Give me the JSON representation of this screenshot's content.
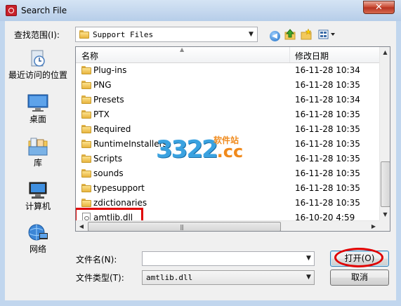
{
  "window": {
    "title": "Search File",
    "close_label": "✕"
  },
  "toolbar": {
    "look_in_label": "查找范围(I):",
    "look_in_value": "Support Files",
    "icons": [
      "back-icon",
      "up-folder-icon",
      "new-folder-icon",
      "views-menu-icon"
    ]
  },
  "places": [
    {
      "label": "最近访问的位置",
      "icon": "recent-places-icon"
    },
    {
      "label": "桌面",
      "icon": "desktop-icon"
    },
    {
      "label": "库",
      "icon": "libraries-icon"
    },
    {
      "label": "计算机",
      "icon": "computer-icon"
    },
    {
      "label": "网络",
      "icon": "network-icon"
    }
  ],
  "file_list": {
    "columns": [
      "名称",
      "修改日期"
    ],
    "rows": [
      {
        "name": "Plug-ins",
        "date": "16-11-28 10:34",
        "type": "folder"
      },
      {
        "name": "PNG",
        "date": "16-11-28 10:35",
        "type": "folder"
      },
      {
        "name": "Presets",
        "date": "16-11-28 10:34",
        "type": "folder"
      },
      {
        "name": "PTX",
        "date": "16-11-28 10:35",
        "type": "folder"
      },
      {
        "name": "Required",
        "date": "16-11-28 10:35",
        "type": "folder"
      },
      {
        "name": "RuntimeInstallers",
        "date": "16-11-28 10:35",
        "type": "folder"
      },
      {
        "name": "Scripts",
        "date": "16-11-28 10:35",
        "type": "folder"
      },
      {
        "name": "sounds",
        "date": "16-11-28 10:35",
        "type": "folder"
      },
      {
        "name": "typesupport",
        "date": "16-11-28 10:35",
        "type": "folder"
      },
      {
        "name": "zdictionaries",
        "date": "16-11-28 10:35",
        "type": "folder"
      },
      {
        "name": "amtlib.dll",
        "date": "16-10-20 4:59",
        "type": "file",
        "highlighted": true
      }
    ]
  },
  "watermark": {
    "number": "3322",
    "suffix": ".cc",
    "chinese": "软件站"
  },
  "form": {
    "file_name_label": "文件名(N):",
    "file_name_value": "",
    "file_type_label": "文件类型(T):",
    "file_type_value": "amtlib.dll",
    "open_button": "打开(O)",
    "cancel_button": "取消"
  },
  "colors": {
    "highlight": "#e00000",
    "folder": "#e8b53f",
    "watermark_blue": "#3aa2e0",
    "watermark_orange": "#f08a1c"
  }
}
